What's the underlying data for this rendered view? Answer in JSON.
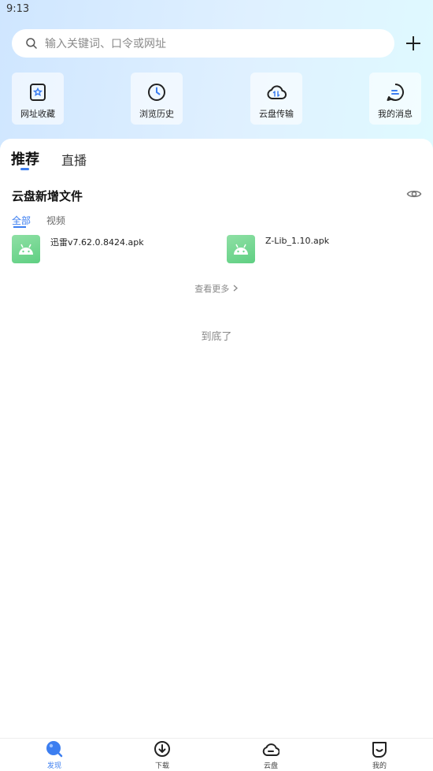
{
  "status_bar": {
    "time": "9:13"
  },
  "search": {
    "placeholder": "输入关键词、口令或网址"
  },
  "quick_actions": [
    {
      "label": "网址收藏",
      "icon": "bookmark-star-icon"
    },
    {
      "label": "浏览历史",
      "icon": "clock-icon"
    },
    {
      "label": "云盘传输",
      "icon": "cloud-transfer-icon"
    },
    {
      "label": "我的消息",
      "icon": "message-icon"
    }
  ],
  "tabs": [
    {
      "label": "推荐",
      "active": true
    },
    {
      "label": "直播",
      "active": false
    }
  ],
  "cloud_section": {
    "title": "云盘新增文件",
    "subtabs": [
      {
        "label": "全部",
        "active": true
      },
      {
        "label": "视频",
        "active": false
      }
    ],
    "files": [
      {
        "name": "迅雷v7.62.0.8424.apk",
        "icon": "android-icon"
      },
      {
        "name": "Z-Lib_1.10.apk",
        "icon": "android-icon"
      }
    ],
    "more_label": "查看更多"
  },
  "end_label": "到底了",
  "bottom_nav": [
    {
      "label": "发现",
      "icon": "discover-icon",
      "active": true
    },
    {
      "label": "下载",
      "icon": "download-icon",
      "active": false
    },
    {
      "label": "云盘",
      "icon": "cloud-icon",
      "active": false
    },
    {
      "label": "我的",
      "icon": "profile-icon",
      "active": false
    }
  ],
  "colors": {
    "accent": "#3c7ef0",
    "file_icon": "#6dd68e"
  }
}
